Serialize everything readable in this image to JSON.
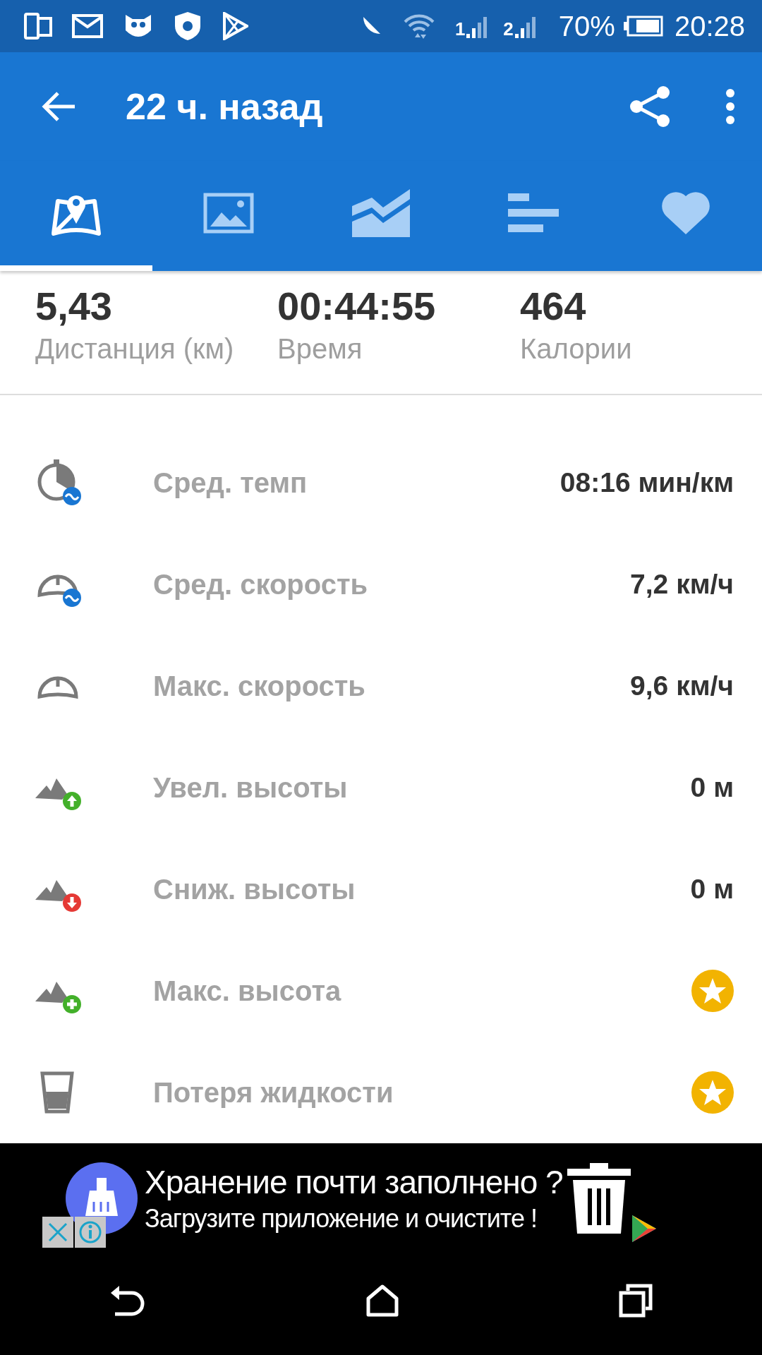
{
  "status_bar": {
    "signals": [
      {
        "label": "1"
      },
      {
        "label": "2"
      }
    ],
    "battery": "70%",
    "time": "20:28"
  },
  "app_bar": {
    "title": "22 ч. назад"
  },
  "tabs": [
    {
      "kind": "map",
      "selected": true
    },
    {
      "kind": "photos",
      "selected": false
    },
    {
      "kind": "chart",
      "selected": false
    },
    {
      "kind": "splits",
      "selected": false
    },
    {
      "kind": "heart",
      "selected": false
    }
  ],
  "summary": [
    {
      "value": "5,43",
      "label": "Дистанция (км)"
    },
    {
      "value": "00:44:55",
      "label": "Время"
    },
    {
      "value": "464",
      "label": "Калории"
    }
  ],
  "stats": [
    {
      "label": "Сред. темп",
      "kind": "value",
      "value": "08:16 мин/км"
    },
    {
      "label": "Сред. скорость",
      "kind": "value",
      "value": "7,2 км/ч"
    },
    {
      "label": "Макс. скорость",
      "kind": "value",
      "value": "9,6 км/ч"
    },
    {
      "label": "Увел. высоты",
      "kind": "value",
      "value": "0 м"
    },
    {
      "label": "Сниж. высоты",
      "kind": "value",
      "value": "0 м"
    },
    {
      "label": "Макс. высота",
      "kind": "premium"
    },
    {
      "label": "Потеря жидкости",
      "kind": "premium"
    }
  ],
  "ad": {
    "headline": "Хранение почти заполнено ?",
    "subline": "Загрузите приложение и очистите !"
  }
}
